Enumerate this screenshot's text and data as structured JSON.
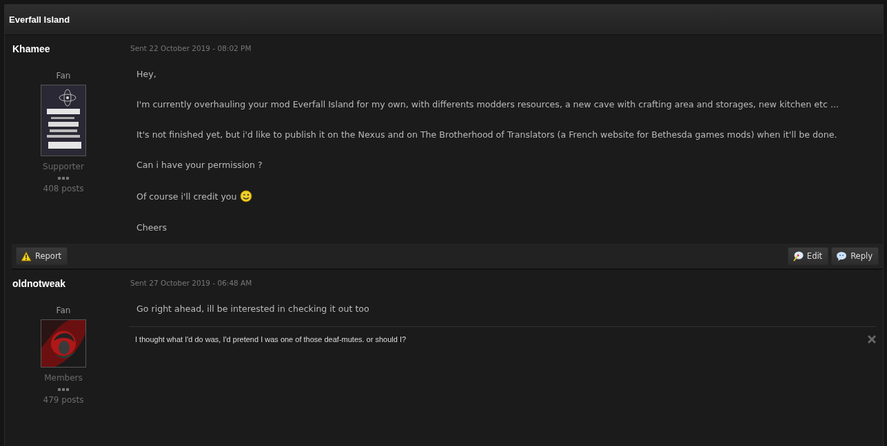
{
  "topic": {
    "title": "Everfall Island"
  },
  "posts": [
    {
      "author": "Khamee",
      "rank": "Fan",
      "avatar": {
        "kind": "picture"
      },
      "group": "Supporter",
      "post_count": "408 posts",
      "date": "Sent 22 October 2019 - 08:02 PM",
      "paragraphs": [
        {
          "text": "Hey,",
          "smiley": false
        },
        {
          "text": "I'm currently overhauling your mod Everfall Island for my own, with differents modders resources, a new cave with crafting area and storages, new kitchen etc ...",
          "smiley": false
        },
        {
          "text": "It's not finished yet, but i'd like to publish it on the Nexus and on The Brotherhood of Translators (a French website for Bethesda games mods) when it'll be done.",
          "smiley": false
        },
        {
          "text": "Can i have your permission ?",
          "smiley": false
        },
        {
          "text": "Of course i'll credit you",
          "smiley": true
        },
        {
          "text": "Cheers",
          "smiley": false
        }
      ],
      "actions": [
        {
          "kind": "report",
          "label": "Report"
        },
        {
          "kind": "edit",
          "label": "Edit"
        },
        {
          "kind": "reply",
          "label": "Reply"
        }
      ]
    },
    {
      "author": "oldnotweak",
      "rank": "Fan",
      "avatar": {
        "kind": "picture"
      },
      "group": "Members",
      "post_count": "479 posts",
      "date": "Sent 27 October 2019 - 06:48 AM",
      "paragraphs": [
        {
          "text": "Go right ahead, ill be interested in checking it out too",
          "smiley": false
        }
      ],
      "signature": "I thought what I'd do was, I'd pretend I was one of those deaf-mutes. or should I?"
    }
  ]
}
